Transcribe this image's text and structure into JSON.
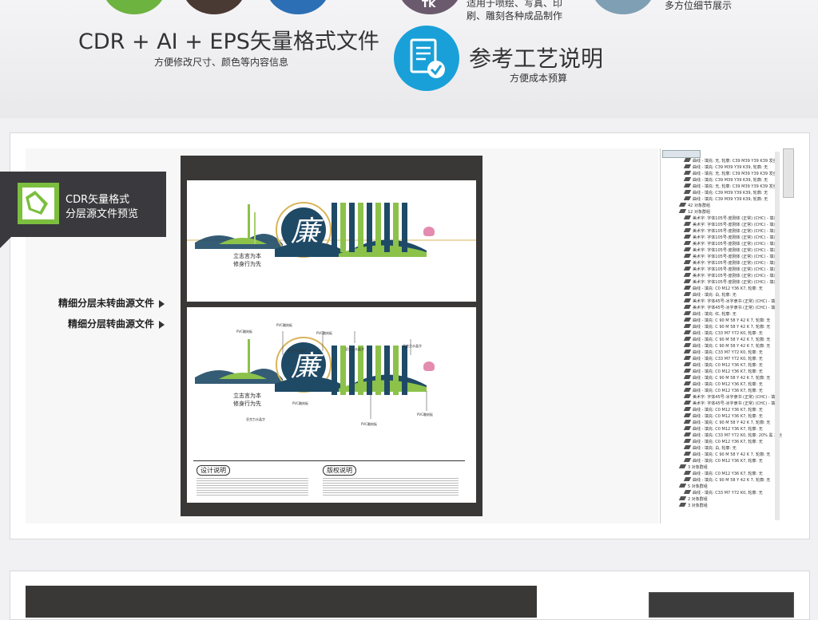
{
  "header": {
    "format_title": "CDR + AI + EPS矢量格式文件",
    "format_subtitle": "方便修改尺寸、颜色等内容信息",
    "craft_title": "参考工艺说明",
    "craft_subtitle": "方便成本预算",
    "applicable_text_1": "适用于喷绘、写真、印",
    "applicable_text_2": "刷、雕刻各种成品制作",
    "detail_text": "多方位细节展示",
    "icon_badge_text": "TK"
  },
  "side_tag": {
    "line1": "CDR矢量格式",
    "line2": "分层源文件预览"
  },
  "source_links": [
    "精细分层未转曲源文件",
    "精细分层转曲源文件"
  ],
  "artboard": {
    "slogan_line1": "立志言为本",
    "slogan_line2": "修身行为先",
    "main_char": "廉",
    "design_heading": "设计说明",
    "copyright_heading": "版权说明",
    "callouts": [
      "PVC雕刻板",
      "PVC雕刻板",
      "亚克力水晶字",
      "亚克力水晶字",
      "亚克力水晶字",
      "PVC雕刻板",
      "PVC雕刻板",
      "PVC雕刻板",
      "PVC雕刻板",
      "亚克力水晶字"
    ]
  },
  "object_tree": {
    "rows": [
      "曲线 - 填充: 无, 轮廓: C39 M39 Y39 K39 发丝",
      "曲线 - 填充: C39 M39 Y39 K39, 轮廓: 无",
      "曲线 - 填充: 无, 轮廓: C39 M39 Y39 K39 发丝",
      "曲线 - 填充: C39 M39 Y39 K39, 轮廓: 无",
      "曲线 - 填充: 无, 轮廓: C39 M39 Y39 K39 发丝",
      "曲线 - 填充: C39 M39 Y39 K39, 轮廓: 无",
      "曲线 - 填充: C39 M39 Y39 K39, 轮廓: 无",
      "42 对象群组",
      "12 对象群组",
      "美术字: 字体105号-庞刚体 (正常) (CHC) - 填充",
      "美术字: 字体105号-庞刚体 (正常) (CHC) - 填充",
      "美术字: 字体105号-庞刚体 (正常) (CHC) - 填充",
      "美术字: 字体105号-庞刚体 (正常) (CHC) - 填充",
      "美术字: 字体105号-庞刚体 (正常) (CHC) - 填充",
      "美术字: 字体105号-庞刚体 (正常) (CHC) - 填充",
      "美术字: 字体105号-庞刚体 (正常) (CHC) - 填充",
      "美术字: 字体105号-庞刚体 (正常) (CHC) - 填充",
      "美术字: 字体105号-庞刚体 (正常) (CHC) - 填充",
      "美术字: 字体105号-庞刚体 (正常) (CHC) - 填充",
      "美术字: 字体105号-庞刚体 (正常) (CHC) - 填充",
      "曲线 - 填充: C0 M12 Y36 K7, 轮廓: 无",
      "曲线 - 填充: 白, 轮廓: 无",
      "美术字: 字体45号-冰字隶书 (正常) (CHC) - 填充",
      "美术字: 字体45号-冰字隶书 (正常) (CHC) - 填充",
      "曲线 - 填充: 红, 轮廓: 无",
      "曲线 - 填充: C 90 M 58 Y 42 K 7, 轮廓: 无",
      "曲线 - 填充: C 90 M 58 Y 42 K 7, 轮廓: 无",
      "曲线 - 填充: C33 M7 Y72 K0, 轮廓: 无",
      "曲线 - 填充: C 90 M 58 Y 42 K 7, 轮廓: 无",
      "曲线 - 填充: C 90 M 58 Y 42 K 7, 轮廓: 无",
      "曲线 - 填充: C33 M7 Y72 K0, 轮廓: 无",
      "曲线 - 填充: C33 M7 Y72 K0, 轮廓: 无",
      "曲线 - 填充: C0 M12 Y36 K7, 轮廓: 无",
      "曲线 - 填充: C0 M12 Y36 K7, 轮廓: 无",
      "曲线 - 填充: C 90 M 58 Y 42 K 7, 轮廓: 无",
      "曲线 - 填充: C0 M12 Y36 K7, 轮廓: 无",
      "曲线 - 填充: C0 M12 Y36 K7, 轮廓: 无",
      "美术字: 字体45号-冰字隶书 (正常) (CHC) - 填充",
      "美术字: 字体45号-冰字隶书 (正常) (CHC) - 填充",
      "曲线 - 填充: C0 M12 Y36 K7, 轮廓: 无",
      "曲线 - 填充: C0 M12 Y36 K7, 轮廓: 无",
      "曲线 - 填充: C 90 M 58 Y 42 K 7, 轮廓: 无",
      "曲线 - 填充: C0 M12 Y36 K7, 轮廓: 无",
      "曲线 - 填充: C33 M7 Y72 K0, 轮廓: 20% 黑 发丝",
      "曲线 - 填充: C0 M12 Y36 K7, 轮廓: 无",
      "曲线 - 填充: 白, 轮廓: 无",
      "曲线 - 填充: C 90 M 58 Y 42 K 7, 轮廓: 无",
      "曲线 - 填充: C0 M12 Y36 K7, 轮廓: 无",
      "3 对象群组",
      "曲线 - 填充: C0 M12 Y36 K7, 轮廓: 无",
      "曲线 - 填充: C 90 M 58 Y 42 K 7, 轮廓: 无",
      "5 对象群组",
      "曲线 - 填充: C33 M7 Y72 K0, 轮廓: 无",
      "2 对象群组",
      "3 对象群组"
    ]
  },
  "colors": {
    "navy": "#1f4a66",
    "green": "#8cc24a",
    "gold": "#d9b45a",
    "pink": "#e48bb0",
    "accent_blue": "#1aa0d8"
  }
}
